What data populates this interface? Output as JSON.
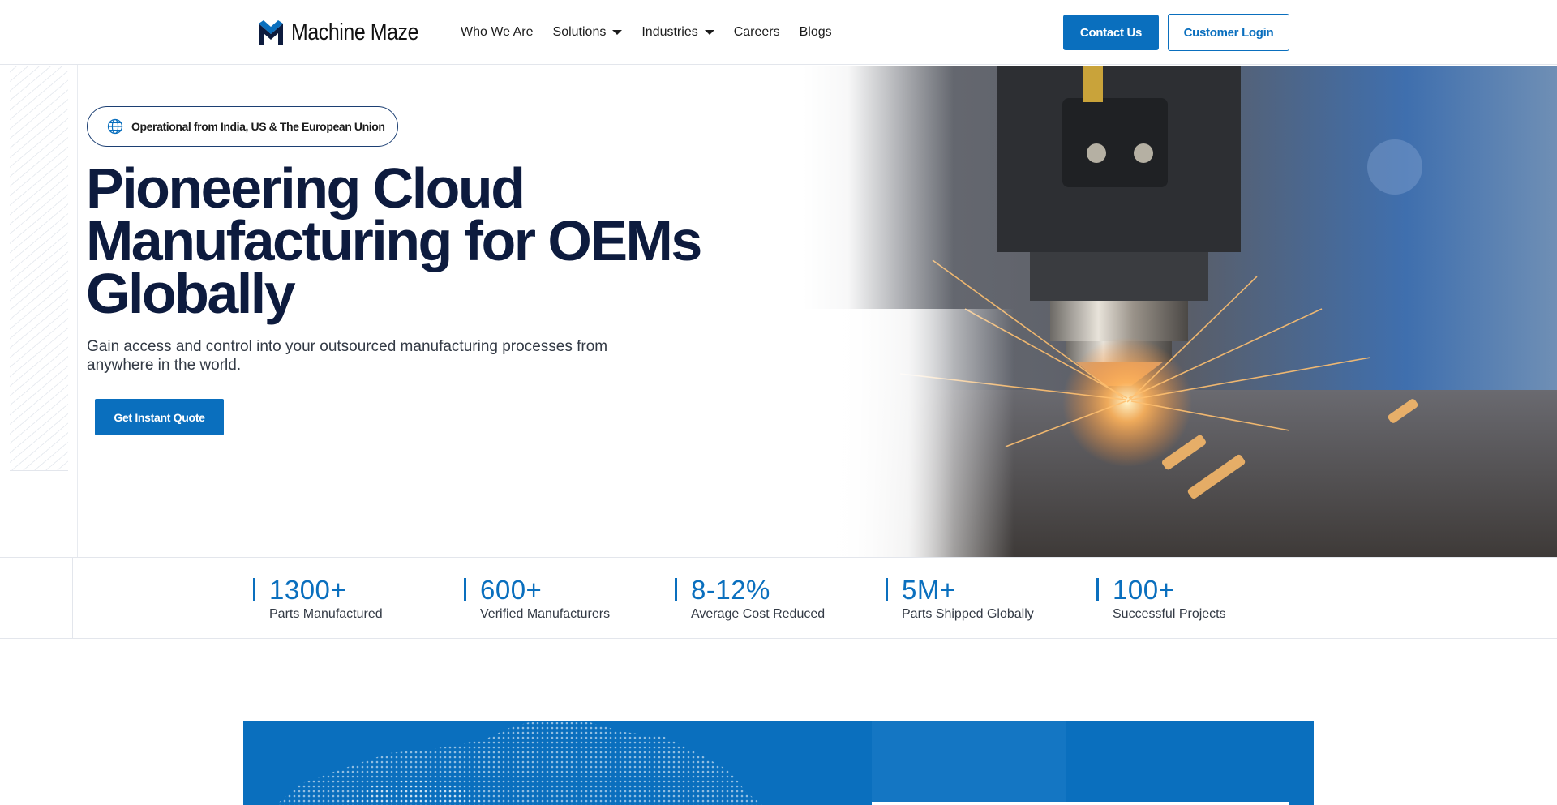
{
  "header": {
    "logo_text": "Machine Maze",
    "nav": [
      {
        "label": "Who We Are",
        "has_dropdown": false
      },
      {
        "label": "Solutions",
        "has_dropdown": true
      },
      {
        "label": "Industries",
        "has_dropdown": true
      },
      {
        "label": "Careers",
        "has_dropdown": false
      },
      {
        "label": "Blogs",
        "has_dropdown": false
      }
    ],
    "contact_label": "Contact Us",
    "login_label": "Customer Login"
  },
  "hero": {
    "badge_icon": "globe-icon",
    "badge_text": "Operational from India, US & The European Union",
    "title_lines": [
      "Pioneering Cloud",
      "Manufacturing for OEMs",
      "Globally"
    ],
    "subtitle_lines": [
      "Gain access and control into your outsourced manufacturing processes from",
      "anywhere in the world."
    ],
    "cta_label": "Get Instant Quote"
  },
  "stats": [
    {
      "value": "1300+",
      "label": "Parts Manufactured"
    },
    {
      "value": "600+",
      "label": "Verified Manufacturers"
    },
    {
      "value": "8-12%",
      "label": "Average Cost Reduced"
    },
    {
      "value": "5M+",
      "label": "Parts Shipped Globally"
    },
    {
      "value": "100+",
      "label": "Successful Projects"
    }
  ],
  "colors": {
    "brand_blue": "#0a6fbe",
    "heading_navy": "#0d1b3e"
  }
}
